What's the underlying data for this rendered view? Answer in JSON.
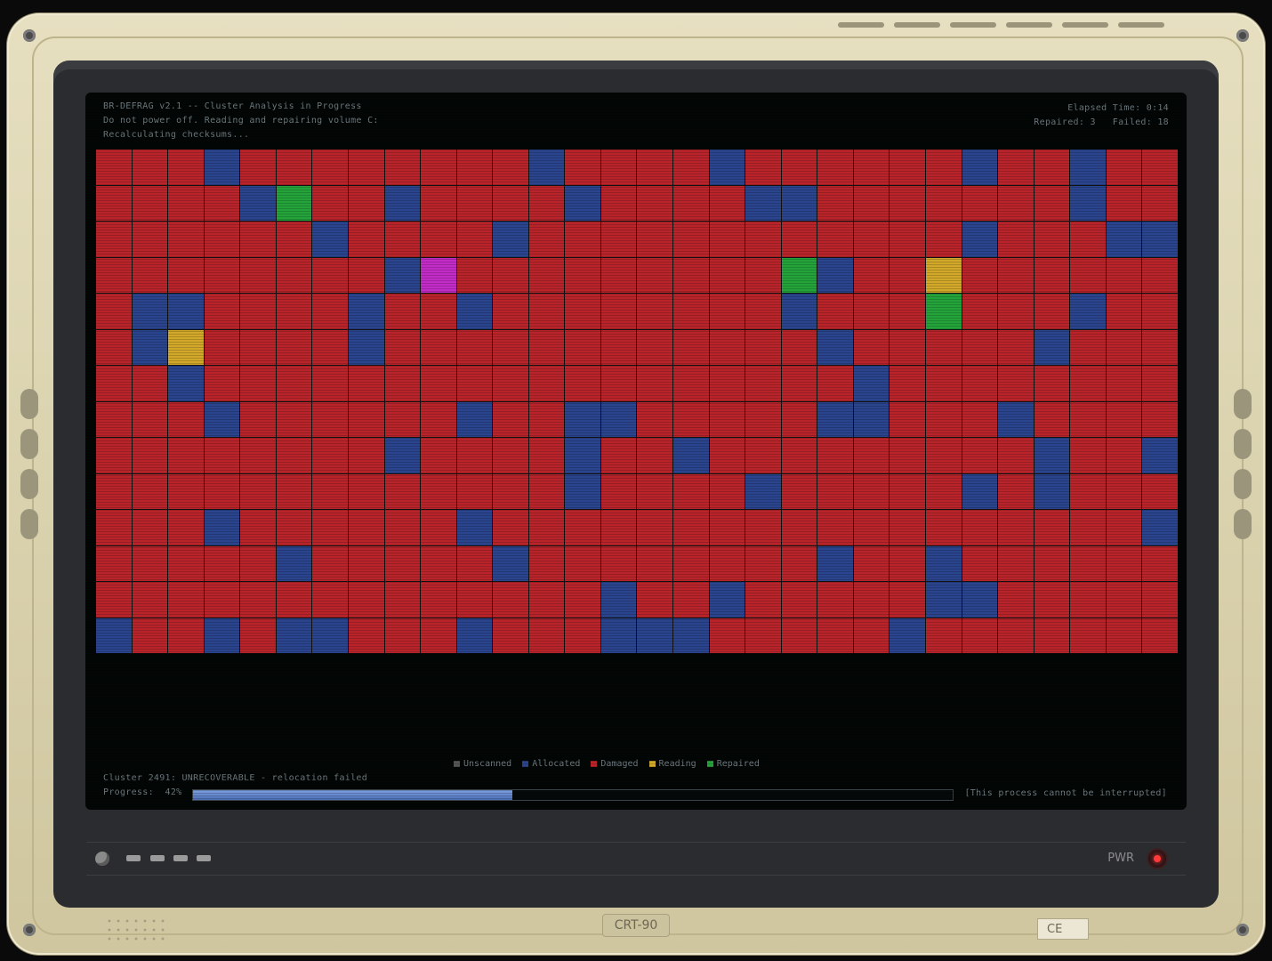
{
  "terminal": {
    "title": "BR-DEFRAG v2.1 -- Cluster Analysis in Progress",
    "line2": "Do not power off. Reading and repairing volume C:",
    "line3": "Recalculating checksums...",
    "elapsed": "Elapsed Time: 0:14",
    "counts": "Repaired: 3   Failed: 18",
    "status_line": "Cluster 2491: UNRECOVERABLE - relocation failed",
    "progress_label": "Progress:  42%",
    "progress_fraction": 0.42,
    "notice": "[This process cannot be interrupted]"
  },
  "legend": [
    {
      "label": "Unscanned",
      "color": "#555555"
    },
    {
      "label": "Allocated",
      "color": "#2a448e"
    },
    {
      "label": "Damaged",
      "color": "#b8242a"
    },
    {
      "label": "Reading",
      "color": "#d2a82a"
    },
    {
      "label": "Repaired",
      "color": "#23a33a"
    }
  ],
  "cluster_map": {
    "rows": 14,
    "cols": 30,
    "legend_codes": {
      "d": "Damaged",
      "a": "Allocated",
      "g": "Repaired",
      "y": "Reading",
      "m": "Reading (highlight)"
    },
    "grid": [
      "dddaddddddddaddddaddddddaddadda",
      "ddddagddaddddaddddaadddddddaddd",
      "ddddddaddddaddddddddddddadddaad",
      "ddddddddamdddddddddgaddyddddddd",
      "daaddddaddaddddddddadddgdddadda",
      "dayddddaddddddddddddadddddaddddd",
      "ddaddddddddddddddddddaddddddddd",
      "dddaddddddaddaadddddaadddadddd",
      "ddddddddaddddaddadddddddddaddaaa",
      "dddddddddddddaddddadddddadaddd",
      "dddaddddddaddddddddddddddddddad",
      "dddddadddddaddddddddaddaddddddd",
      "ddddddddddddddaddadddddaaddddddda",
      "addadaadddadddaaadddddaddddddddd"
    ]
  },
  "controls": {
    "pwr_label": "PWR"
  },
  "case": {
    "model": "CRT-90",
    "ce_mark": "CE"
  }
}
